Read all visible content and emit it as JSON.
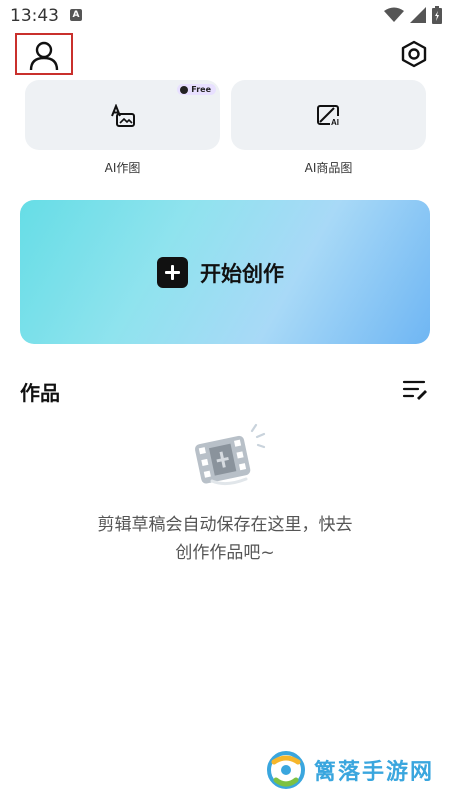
{
  "status": {
    "time": "13:43",
    "notif_letter": "A"
  },
  "tools": [
    {
      "label": "AI作图",
      "badge": "Free"
    },
    {
      "label": "AI商品图"
    }
  ],
  "start": {
    "label": "开始创作"
  },
  "works": {
    "title": "作品",
    "empty_line1": "剪辑草稿会自动保存在这里，快去",
    "empty_line2": "创作作品吧~"
  },
  "watermark": {
    "text": "篱落手游网"
  },
  "colors": {
    "accent_gradient_start": "#66dde6",
    "accent_gradient_end": "#6fb6f3",
    "card_bg": "#eef1f4",
    "watermark": "#3aa6de"
  }
}
